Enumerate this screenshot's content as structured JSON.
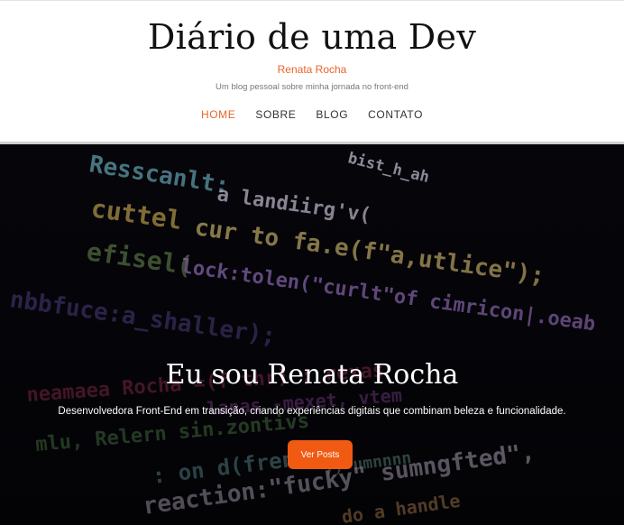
{
  "header": {
    "title": "Diário de uma Dev",
    "author": "Renata Rocha",
    "tagline": "Um blog pessoal sobre minha jornada no front-end"
  },
  "nav": {
    "items": [
      {
        "label": "HOME",
        "active": true
      },
      {
        "label": "SOBRE",
        "active": false
      },
      {
        "label": "BLOG",
        "active": false
      },
      {
        "label": "CONTATO",
        "active": false
      }
    ]
  },
  "hero": {
    "title": "Eu sou Renata Rocha",
    "subtitle": "Desenvolvedora Front-End em transição, criando experiências digitais que combinam beleza e funcionalidade.",
    "button_label": "Ver Posts",
    "background_image": "code-editor-screen"
  },
  "colors": {
    "accent": "#e8642c",
    "button": "#f05a12",
    "hero_bg": "#07060c"
  }
}
